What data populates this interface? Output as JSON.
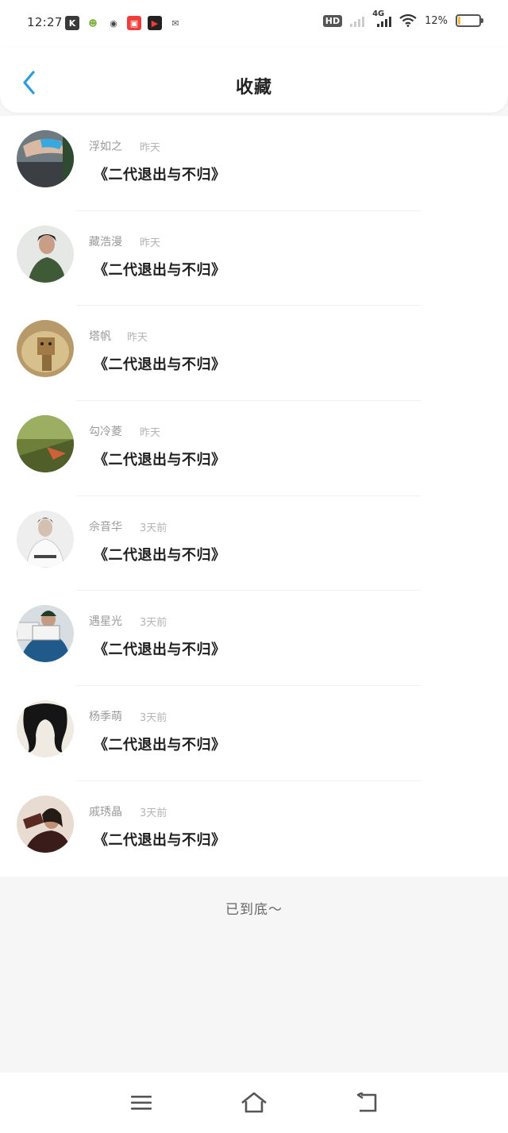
{
  "status_bar": {
    "time": "12:27",
    "notification_icons": [
      {
        "name": "k-app-icon",
        "glyph": "K",
        "color": "#3a3a3a"
      },
      {
        "name": "game-app-icon",
        "glyph": "☻",
        "color": "#8bc34a"
      },
      {
        "name": "map-pin-app-icon",
        "glyph": "◉",
        "color": "#444444"
      },
      {
        "name": "video-app-icon",
        "glyph": "▣",
        "color": "#f23b3b"
      },
      {
        "name": "record-app-icon",
        "glyph": "▶",
        "color": "#222222"
      },
      {
        "name": "wechat-icon",
        "glyph": "✉",
        "color": "#555555"
      }
    ],
    "hd_label": "HD",
    "network_label": "4G",
    "battery_text": "12%",
    "battery_level": 0.12,
    "battery_color": "#f5b83d"
  },
  "header": {
    "back_icon": "chevron-left-icon",
    "title": "收藏",
    "accent_color": "#2d9cdb"
  },
  "items": [
    {
      "name": "浮如之",
      "time": "昨天",
      "title": "《二代退出与不归》"
    },
    {
      "name": "藏浩漫",
      "time": "昨天",
      "title": "《二代退出与不归》"
    },
    {
      "name": "塔帆",
      "time": "昨天",
      "title": "《二代退出与不归》"
    },
    {
      "name": "勾冷菱",
      "time": "昨天",
      "title": "《二代退出与不归》"
    },
    {
      "name": "佘音华",
      "time": "3天前",
      "title": "《二代退出与不归》"
    },
    {
      "name": "遇星光",
      "time": "3天前",
      "title": "《二代退出与不归》"
    },
    {
      "name": "杨季萌",
      "time": "3天前",
      "title": "《二代退出与不归》"
    },
    {
      "name": "戚琇晶",
      "time": "3天前",
      "title": "《二代退出与不归》"
    }
  ],
  "footer": {
    "end_text": "已到底～"
  },
  "nav_bar": {
    "menu_icon": "menu-icon",
    "home_icon": "home-icon",
    "back_icon": "back-icon"
  }
}
